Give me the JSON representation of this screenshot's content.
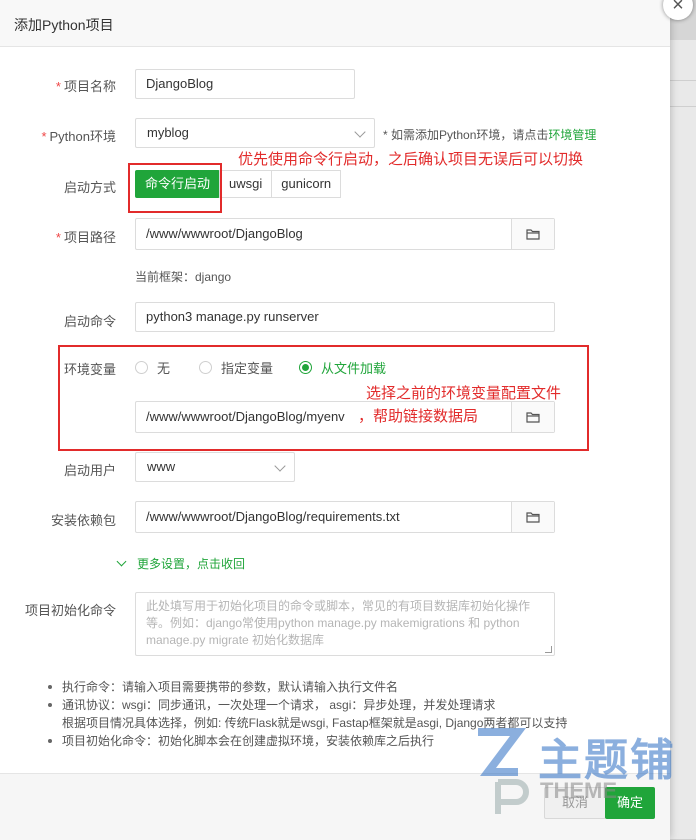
{
  "dialog": {
    "title": "添加Python项目",
    "close": "×"
  },
  "form": {
    "project_name": {
      "label": "项目名称",
      "required_mark": "*",
      "value": "DjangoBlog"
    },
    "python_env": {
      "label": "Python环境",
      "required_mark": "*",
      "value": "myblog",
      "hint_prefix": "* 如需添加Python环境，请点击",
      "hint_link": "环境管理"
    },
    "start_mode": {
      "label": "启动方式",
      "options": [
        "命令行启动",
        "uwsgi",
        "gunicorn"
      ],
      "selected": "命令行启动"
    },
    "project_path": {
      "label": "项目路径",
      "required_mark": "*",
      "value": "/www/wwwroot/DjangoBlog"
    },
    "framework": {
      "text": "当前框架：django"
    },
    "start_command": {
      "label": "启动命令",
      "value": "python3 manage.py runserver"
    },
    "env_vars": {
      "label": "环境变量",
      "options": [
        "无",
        "指定变量",
        "从文件加载"
      ],
      "selected": "从文件加载",
      "file_path": "/www/wwwroot/DjangoBlog/myenv"
    },
    "start_user": {
      "label": "启动用户",
      "value": "www"
    },
    "install_deps": {
      "label": "安装依赖包",
      "value": "/www/wwwroot/DjangoBlog/requirements.txt"
    },
    "more_settings": {
      "text": "更多设置，点击收回"
    },
    "init_command": {
      "label": "项目初始化命令",
      "placeholder": "此处填写用于初始化项目的命令或脚本，常见的有项目数据库初始化操作等。例如：django常使用python manage.py makemigrations 和 python manage.py migrate 初始化数据库"
    }
  },
  "annotations": {
    "note1": "优先使用命令行启动，之后确认项目无误后可以切换",
    "note2_line1": "选择之前的环境变量配置文件",
    "note2_line2": "，帮助链接数据局",
    "color": "#e22b2b"
  },
  "notes": [
    "执行命令：请输入项目需要携带的参数，默认请输入执行文件名",
    "通讯协议：wsgi：同步通讯，一次处理一个请求， asgi：异步处理，并发处理请求",
    "根据项目情况具体选择，例如: 传统Flask就是wsgi, Fastap框架就是asgi, Django两者都可以支持",
    "项目初始化命令：初始化脚本会在创建虚拟环境，安装依赖库之后执行"
  ],
  "footer": {
    "cancel": "取消",
    "confirm": "确定"
  },
  "watermark": {
    "text": "主题铺",
    "sub": "THEME"
  },
  "theme": {
    "accent": "#20a53a",
    "danger": "#e22b2b"
  }
}
